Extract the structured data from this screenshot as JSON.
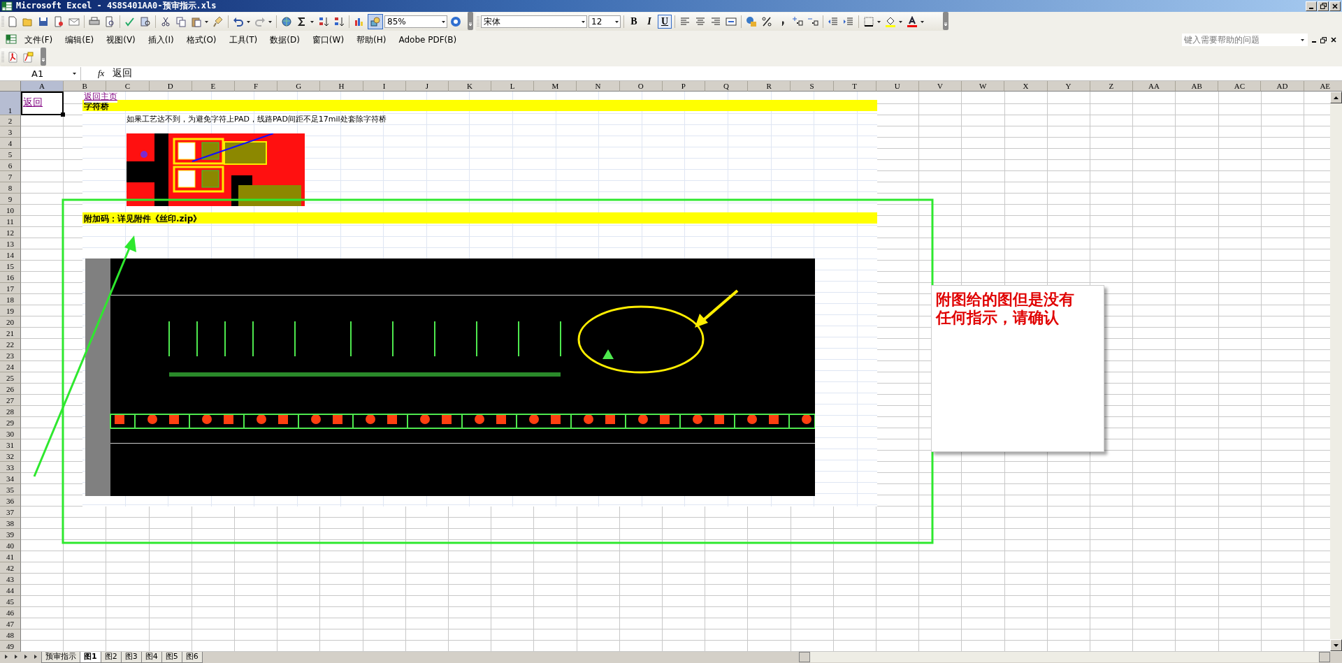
{
  "window": {
    "title": "Microsoft Excel - 4S8S401AA0-预审指示.xls"
  },
  "standard_toolbar": {
    "zoom": "85%",
    "drawing_toggle": {
      "selected": true
    }
  },
  "formatting_toolbar": {
    "font": "宋体",
    "size": "12",
    "styles": [
      {
        "label": "B",
        "kind": "bold",
        "selected": false
      },
      {
        "label": "I",
        "kind": "italic",
        "selected": false
      },
      {
        "label": "U",
        "kind": "underline",
        "selected": true
      }
    ]
  },
  "menu": [
    "文件(F)",
    "编辑(E)",
    "视图(V)",
    "插入(I)",
    "格式(O)",
    "工具(T)",
    "数据(D)",
    "窗口(W)",
    "帮助(H)",
    "Adobe PDF(B)"
  ],
  "help_box": {
    "placeholder": "键入需要帮助的问题"
  },
  "formula_bar": {
    "name_box": "A1",
    "function_label": "fx",
    "value": "返回"
  },
  "columns": [
    {
      "label": "A",
      "selected": true
    },
    {
      "label": "B",
      "selected": false
    },
    {
      "label": "C",
      "selected": false
    },
    {
      "label": "D",
      "selected": false
    },
    {
      "label": "E",
      "selected": false
    },
    {
      "label": "F",
      "selected": false
    },
    {
      "label": "G",
      "selected": false
    },
    {
      "label": "H",
      "selected": false
    },
    {
      "label": "I",
      "selected": false
    },
    {
      "label": "J",
      "selected": false
    },
    {
      "label": "K",
      "selected": false
    },
    {
      "label": "L",
      "selected": false
    },
    {
      "label": "M",
      "selected": false
    },
    {
      "label": "N",
      "selected": false
    },
    {
      "label": "O",
      "selected": false
    },
    {
      "label": "P",
      "selected": false
    },
    {
      "label": "Q",
      "selected": false
    },
    {
      "label": "R",
      "selected": false
    },
    {
      "label": "S",
      "selected": false
    },
    {
      "label": "T",
      "selected": false
    },
    {
      "label": "U",
      "selected": false
    },
    {
      "label": "V",
      "selected": false
    },
    {
      "label": "W",
      "selected": false
    },
    {
      "label": "X",
      "selected": false
    },
    {
      "label": "Y",
      "selected": false
    },
    {
      "label": "Z",
      "selected": false
    },
    {
      "label": "AA",
      "selected": false
    },
    {
      "label": "AB",
      "selected": false
    },
    {
      "label": "AC",
      "selected": false
    },
    {
      "label": "AD",
      "selected": false
    },
    {
      "label": "AE",
      "selected": false
    }
  ],
  "rows": [
    {
      "label": "1",
      "selected": true
    },
    {
      "label": "2",
      "selected": false
    },
    {
      "label": "3",
      "selected": false
    },
    {
      "label": "4",
      "selected": false
    },
    {
      "label": "5",
      "selected": false
    },
    {
      "label": "6",
      "selected": false
    },
    {
      "label": "7",
      "selected": false
    },
    {
      "label": "8",
      "selected": false
    },
    {
      "label": "9",
      "selected": false
    },
    {
      "label": "10",
      "selected": false
    },
    {
      "label": "11",
      "selected": false
    },
    {
      "label": "12",
      "selected": false
    },
    {
      "label": "13",
      "selected": false
    },
    {
      "label": "14",
      "selected": false
    },
    {
      "label": "15",
      "selected": false
    },
    {
      "label": "16",
      "selected": false
    },
    {
      "label": "17",
      "selected": false
    },
    {
      "label": "18",
      "selected": false
    },
    {
      "label": "19",
      "selected": false
    },
    {
      "label": "20",
      "selected": false
    },
    {
      "label": "21",
      "selected": false
    },
    {
      "label": "22",
      "selected": false
    },
    {
      "label": "23",
      "selected": false
    },
    {
      "label": "24",
      "selected": false
    },
    {
      "label": "25",
      "selected": false
    },
    {
      "label": "26",
      "selected": false
    },
    {
      "label": "27",
      "selected": false
    },
    {
      "label": "28",
      "selected": false
    },
    {
      "label": "29",
      "selected": false
    },
    {
      "label": "30",
      "selected": false
    },
    {
      "label": "31",
      "selected": false
    },
    {
      "label": "32",
      "selected": false
    },
    {
      "label": "33",
      "selected": false
    },
    {
      "label": "34",
      "selected": false
    },
    {
      "label": "35",
      "selected": false
    },
    {
      "label": "36",
      "selected": false
    },
    {
      "label": "37",
      "selected": false
    },
    {
      "label": "38",
      "selected": false
    },
    {
      "label": "39",
      "selected": false
    },
    {
      "label": "40",
      "selected": false
    },
    {
      "label": "41",
      "selected": false
    },
    {
      "label": "42",
      "selected": false
    },
    {
      "label": "43",
      "selected": false
    },
    {
      "label": "44",
      "selected": false
    },
    {
      "label": "45",
      "selected": false
    },
    {
      "label": "46",
      "selected": false
    },
    {
      "label": "47",
      "selected": false
    },
    {
      "label": "48",
      "selected": false
    },
    {
      "label": "49",
      "selected": false
    }
  ],
  "sheet": {
    "a1_link": "返回",
    "home_link": "返回主页",
    "heading_1": "字符桥",
    "note": "如果工艺达不到，为避免字符上PAD，线路PAD间距不足17mil处套除字符桥",
    "heading_2": "附加码：详见附件《丝印.zip》",
    "comment": "附图给的图但是没有任何指示，请确认"
  },
  "sheet_tabs": [
    {
      "label": "预审指示",
      "selected": false
    },
    {
      "label": "图1",
      "selected": true
    },
    {
      "label": "图2",
      "selected": false
    },
    {
      "label": "图3",
      "selected": false
    },
    {
      "label": "图4",
      "selected": false
    },
    {
      "label": "图5",
      "selected": false
    },
    {
      "label": "图6",
      "selected": false
    }
  ]
}
